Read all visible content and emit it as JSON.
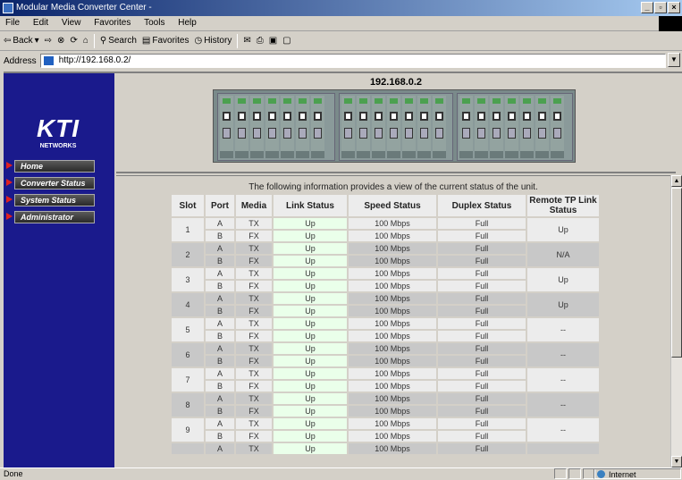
{
  "window": {
    "title": "Modular Media Converter Center -"
  },
  "menu": [
    "File",
    "Edit",
    "View",
    "Favorites",
    "Tools",
    "Help"
  ],
  "toolbar": {
    "back": "Back",
    "search": "Search",
    "favorites": "Favorites",
    "history": "History"
  },
  "address": {
    "label": "Address",
    "url": "http://192.168.0.2/"
  },
  "brand": {
    "logo": "KTI",
    "sub": "NETWORKS"
  },
  "nav": [
    {
      "label": "Home"
    },
    {
      "label": "Converter Status"
    },
    {
      "label": "System Status"
    },
    {
      "label": "Administrator"
    }
  ],
  "device": {
    "ip": "192.168.0.2"
  },
  "main": {
    "intro": "The following information provides a view of the current status of the unit.",
    "headers": [
      "Slot",
      "Port",
      "Media",
      "Link Status",
      "Speed Status",
      "Duplex Status",
      "Remote TP Link Status"
    ],
    "slots": [
      {
        "slot": "1",
        "ports": [
          [
            "A",
            "TX",
            "Up",
            "100 Mbps",
            "Full"
          ],
          [
            "B",
            "FX",
            "Up",
            "100 Mbps",
            "Full"
          ]
        ],
        "remote": "Up"
      },
      {
        "slot": "2",
        "ports": [
          [
            "A",
            "TX",
            "Up",
            "100 Mbps",
            "Full"
          ],
          [
            "B",
            "FX",
            "Up",
            "100 Mbps",
            "Full"
          ]
        ],
        "remote": "N/A"
      },
      {
        "slot": "3",
        "ports": [
          [
            "A",
            "TX",
            "Up",
            "100 Mbps",
            "Full"
          ],
          [
            "B",
            "FX",
            "Up",
            "100 Mbps",
            "Full"
          ]
        ],
        "remote": "Up"
      },
      {
        "slot": "4",
        "ports": [
          [
            "A",
            "TX",
            "Up",
            "100 Mbps",
            "Full"
          ],
          [
            "B",
            "FX",
            "Up",
            "100 Mbps",
            "Full"
          ]
        ],
        "remote": "Up"
      },
      {
        "slot": "5",
        "ports": [
          [
            "A",
            "TX",
            "Up",
            "100 Mbps",
            "Full"
          ],
          [
            "B",
            "FX",
            "Up",
            "100 Mbps",
            "Full"
          ]
        ],
        "remote": "--"
      },
      {
        "slot": "6",
        "ports": [
          [
            "A",
            "TX",
            "Up",
            "100 Mbps",
            "Full"
          ],
          [
            "B",
            "FX",
            "Up",
            "100 Mbps",
            "Full"
          ]
        ],
        "remote": "--"
      },
      {
        "slot": "7",
        "ports": [
          [
            "A",
            "TX",
            "Up",
            "100 Mbps",
            "Full"
          ],
          [
            "B",
            "FX",
            "Up",
            "100 Mbps",
            "Full"
          ]
        ],
        "remote": "--"
      },
      {
        "slot": "8",
        "ports": [
          [
            "A",
            "TX",
            "Up",
            "100 Mbps",
            "Full"
          ],
          [
            "B",
            "FX",
            "Up",
            "100 Mbps",
            "Full"
          ]
        ],
        "remote": "--"
      },
      {
        "slot": "9",
        "ports": [
          [
            "A",
            "TX",
            "Up",
            "100 Mbps",
            "Full"
          ],
          [
            "B",
            "FX",
            "Up",
            "100 Mbps",
            "Full"
          ]
        ],
        "remote": "--"
      },
      {
        "slot": "",
        "ports": [
          [
            "A",
            "TX",
            "Up",
            "100 Mbps",
            "Full"
          ]
        ],
        "remote": ""
      }
    ]
  },
  "statusbar": {
    "left": "Done",
    "zone": "Internet"
  }
}
